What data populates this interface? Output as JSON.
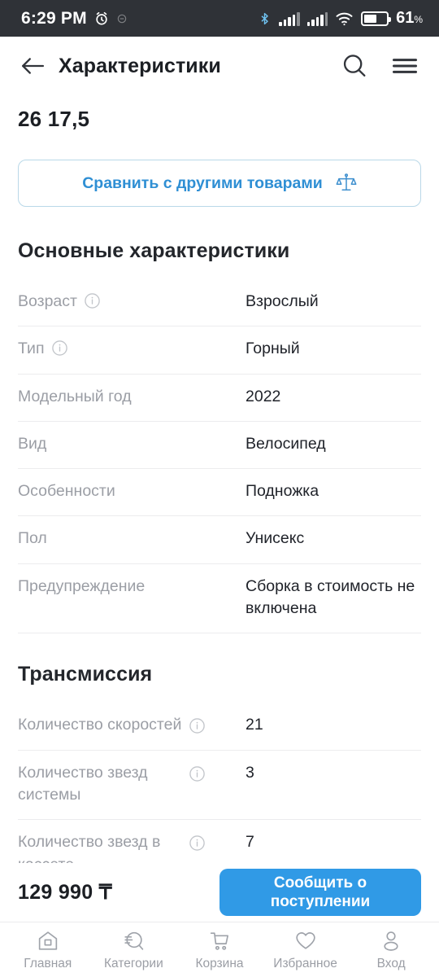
{
  "status_bar": {
    "time": "6:29 PM",
    "alarm_icon": "alarm-clock-icon",
    "secondary_icon": "muted-indicator-icon",
    "bluetooth_icon": "bluetooth-icon",
    "signal_icon": "cellular-signal-icon",
    "wifi_icon": "wifi-icon",
    "battery_icon": "battery-icon",
    "battery_percent": "61",
    "battery_unit": "%",
    "background_color": "#2f3237"
  },
  "header": {
    "back_icon": "back-arrow-icon",
    "title": "Характеристики",
    "search_icon": "search-icon",
    "menu_icon": "hamburger-menu-icon"
  },
  "product": {
    "title": "26 17,5"
  },
  "compare": {
    "label": "Сравнить с другими товарами",
    "icon": "scales-balance-icon",
    "text_color": "#2f8fd4",
    "border_color": "#b9d8e8"
  },
  "sections": [
    {
      "title": "Основные характеристики",
      "layout": "simple",
      "rows": [
        {
          "key": "Возраст",
          "info": true,
          "value": "Взрослый"
        },
        {
          "key": "Тип",
          "info": true,
          "value": "Горный"
        },
        {
          "key": "Модельный год",
          "info": false,
          "value": "2022"
        },
        {
          "key": "Вид",
          "info": false,
          "value": "Велосипед"
        },
        {
          "key": "Особенности",
          "info": false,
          "value": "Подножка"
        },
        {
          "key": "Пол",
          "info": false,
          "value": "Унисекс"
        },
        {
          "key": "Предупреждение",
          "info": false,
          "value": "Сборка в стоимость не включена"
        }
      ]
    },
    {
      "title": "Трансмиссия",
      "layout": "columns",
      "rows": [
        {
          "key": "Количество скоростей",
          "info": true,
          "value": "21"
        },
        {
          "key": "Количество звезд системы",
          "info": true,
          "value": "3"
        },
        {
          "key": "Количество звезд в кассете",
          "info": true,
          "value": "7"
        }
      ]
    }
  ],
  "price_bar": {
    "price": "129 990 ₸",
    "notify_label": "Сообщить о поступлении",
    "notify_color": "#309ae6"
  },
  "bottom_nav": [
    {
      "label": "Главная",
      "icon": "home-icon"
    },
    {
      "label": "Категории",
      "icon": "categories-search-icon"
    },
    {
      "label": "Корзина",
      "icon": "cart-icon"
    },
    {
      "label": "Избранное",
      "icon": "heart-icon"
    },
    {
      "label": "Вход",
      "icon": "user-icon"
    }
  ]
}
